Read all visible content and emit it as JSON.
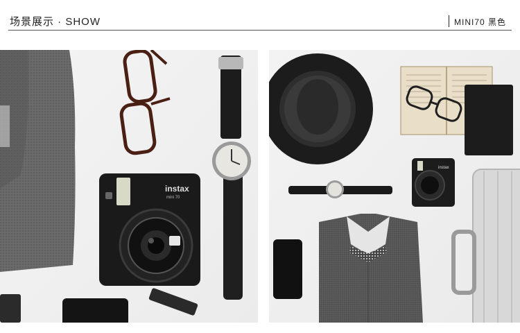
{
  "header": {
    "title": "场景展示 · SHOW",
    "model": "MINI70 黑色"
  },
  "scene_left": {
    "camera_brand": "instax",
    "camera_model": "mini 70"
  },
  "scene_right": {
    "camera_brand": "instax"
  }
}
